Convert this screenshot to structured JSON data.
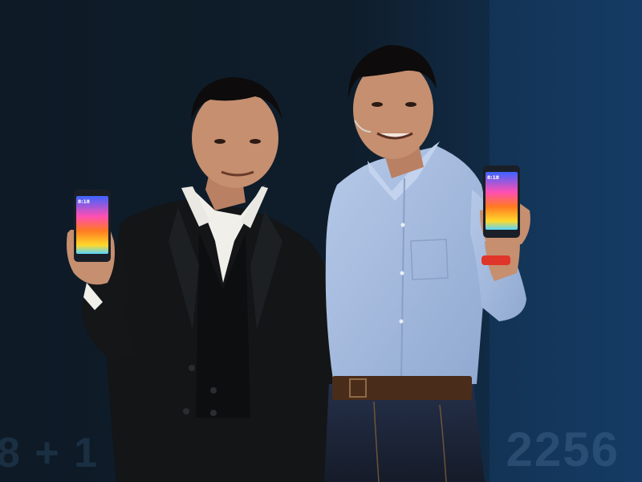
{
  "scene": {
    "description_colors": {
      "backdrop_dark": "#0c1520",
      "backdrop_blue": "#12355a",
      "suit_black": "#121416",
      "shirt_white": "#f1f0ec",
      "shirt_blue": "#a9c0e2",
      "jeans_navy": "#1b2233",
      "skin": "#c58f70",
      "hair": "#0d0b0b",
      "belt_brown": "#4a2c1b",
      "wristband_red": "#e0352a"
    }
  },
  "background_screen": {
    "right_digits": "2256",
    "left_digits": "8 + 1"
  },
  "phones": {
    "left_time": "8:18",
    "right_time": "8:18"
  }
}
